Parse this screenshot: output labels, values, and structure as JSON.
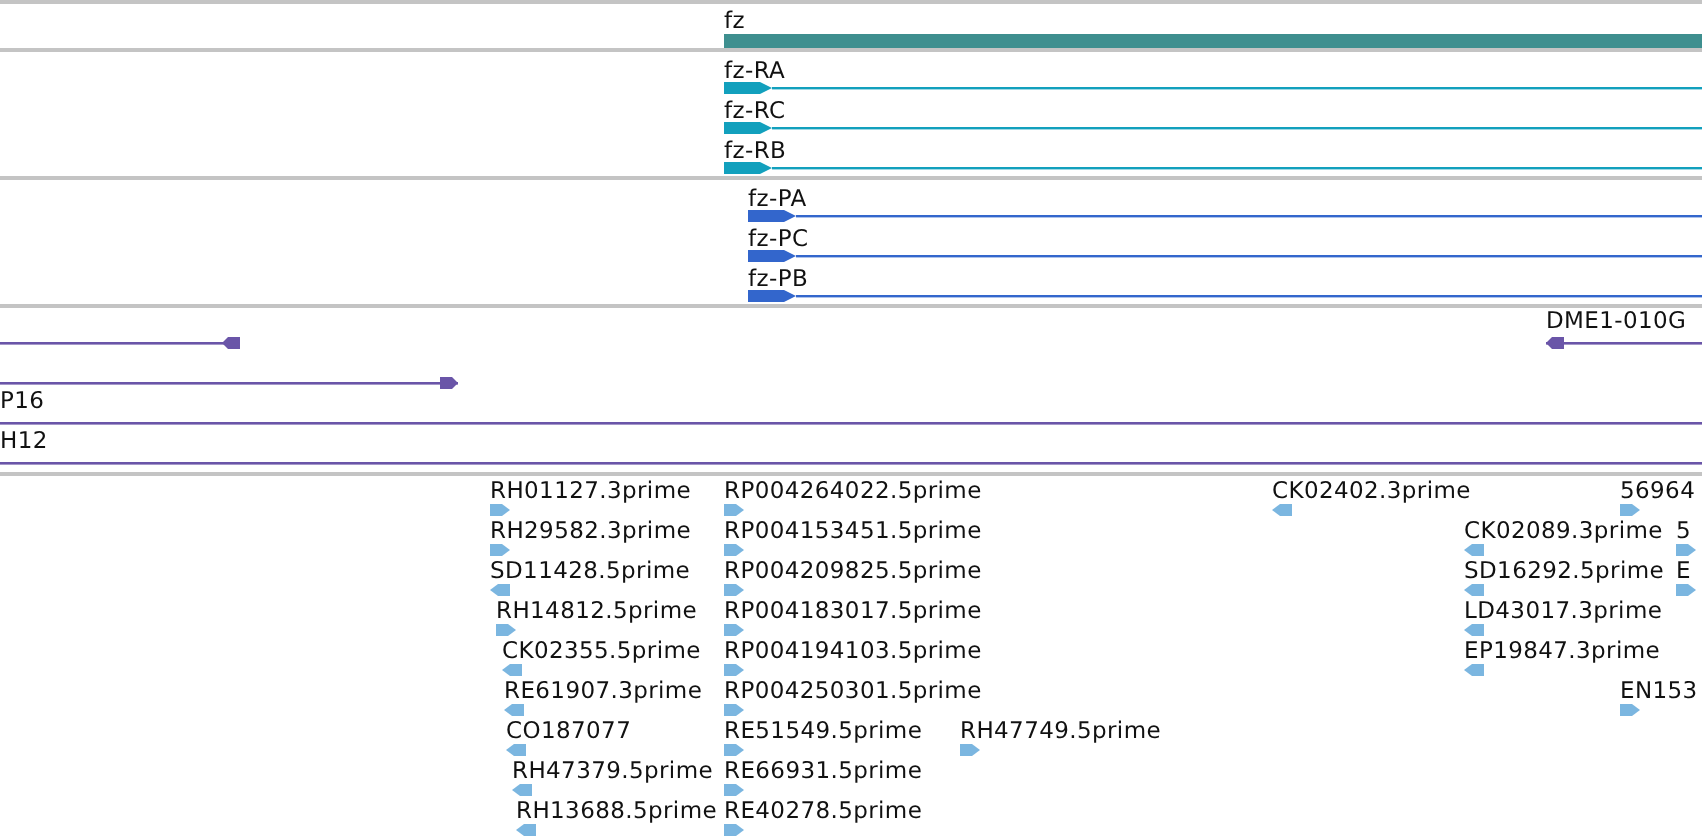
{
  "tracks": [
    {
      "kind": "gene",
      "features": [
        {
          "label": "fz"
        }
      ]
    },
    {
      "kind": "transcript",
      "features": [
        {
          "label": "fz-RA"
        },
        {
          "label": "fz-RC"
        },
        {
          "label": "fz-RB"
        }
      ]
    },
    {
      "kind": "protein",
      "features": [
        {
          "label": "fz-PA"
        },
        {
          "label": "fz-PC"
        },
        {
          "label": "fz-PB"
        }
      ]
    },
    {
      "kind": "alignment",
      "features": [
        {
          "reverse": true
        },
        {
          "label": "DME1-010G",
          "reverse": true
        },
        {
          "reverse": false
        },
        {
          "label": "P16"
        },
        {
          "label": "H12"
        }
      ]
    },
    {
      "kind": "est",
      "features": [
        {
          "label": "RH01127.3prime",
          "reverse": false
        },
        {
          "label": "RP004264022.5prime",
          "reverse": false
        },
        {
          "label": "CK02402.3prime",
          "reverse": true
        },
        {
          "label": "56964",
          "reverse": false
        },
        {
          "label": "RH29582.3prime",
          "reverse": false
        },
        {
          "label": "RP004153451.5prime",
          "reverse": false
        },
        {
          "label": "CK02089.3prime",
          "reverse": true
        },
        {
          "label": "5",
          "reverse": false
        },
        {
          "label": "SD11428.5prime",
          "reverse": true
        },
        {
          "label": "RP004209825.5prime",
          "reverse": false
        },
        {
          "label": "SD16292.5prime",
          "reverse": true
        },
        {
          "label": "E",
          "reverse": false
        },
        {
          "label": "RH14812.5prime",
          "reverse": false
        },
        {
          "label": "RP004183017.5prime",
          "reverse": false
        },
        {
          "label": "LD43017.3prime",
          "reverse": true
        },
        {
          "label": "CK02355.5prime",
          "reverse": true
        },
        {
          "label": "RP004194103.5prime",
          "reverse": false
        },
        {
          "label": "EP19847.3prime",
          "reverse": true
        },
        {
          "label": "RE61907.3prime",
          "reverse": true
        },
        {
          "label": "RP004250301.5prime",
          "reverse": false
        },
        {
          "label": "EN153",
          "reverse": false
        },
        {
          "label": "CO187077",
          "reverse": true
        },
        {
          "label": "RE51549.5prime",
          "reverse": false
        },
        {
          "label": "RH47749.5prime",
          "reverse": false
        },
        {
          "label": "RH47379.5prime",
          "reverse": true
        },
        {
          "label": "RE66931.5prime",
          "reverse": false
        },
        {
          "label": "RH13688.5prime",
          "reverse": true
        },
        {
          "label": "RE40278.5prime",
          "reverse": false
        }
      ]
    }
  ]
}
